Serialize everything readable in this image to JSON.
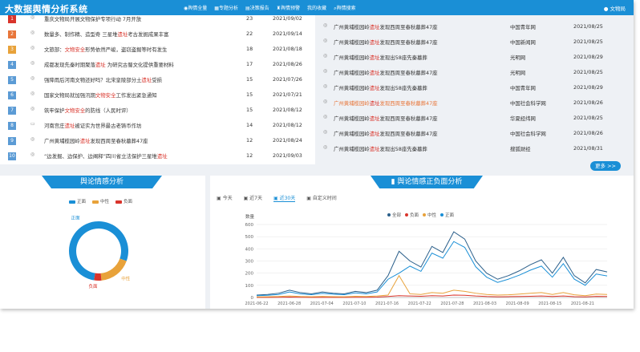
{
  "app": {
    "title": "大数据舆情分析系统",
    "user": "文物局",
    "nav": [
      "舆情全量",
      "专题分析",
      "决策报告",
      "舆情预警",
      "我的收藏",
      "舆情搜索"
    ],
    "colors": {
      "accent": "#1a8fd6",
      "keyword": "#d9342b"
    }
  },
  "hot_list": [
    {
      "rank": "1",
      "t1": "重庆文物局开展文物保护",
      "kw": "",
      "t2": "专项行动 7月开放",
      "num": "23",
      "date": "2021/09/02",
      "color": "#d9342b"
    },
    {
      "rank": "2",
      "t1": "数量多、制作精、造型奇 三星堆",
      "kw": "遗址",
      "t2": "考古发掘成果丰富",
      "num": "22",
      "date": "2021/09/14",
      "color": "#e8763a"
    },
    {
      "rank": "3",
      "t1": "文旅部：",
      "kw": "文物安全",
      "t2": "形势依然严峻，盗窃盗掘等时有发生",
      "num": "18",
      "date": "2021/08/18",
      "color": "#e8a23a"
    },
    {
      "rank": "4",
      "t1": "成都发现先秦时期聚落",
      "kw": "遗址",
      "t2": " 为研究古蜀文化提供重要材料",
      "num": "17",
      "date": "2021/08/26",
      "color": "#5b9bd5"
    },
    {
      "rank": "5",
      "t1": "强降雨后河南文物还好吗？北宋皇陵部分土",
      "kw": "遗址",
      "t2": "受损",
      "num": "15",
      "date": "2021/07/26",
      "color": "#5b9bd5"
    },
    {
      "rank": "6",
      "t1": "国家文物局就加强汛期",
      "kw": "文物安全",
      "t2": "工作发出紧急通知",
      "num": "15",
      "date": "2021/07/21",
      "color": "#5b9bd5"
    },
    {
      "rank": "7",
      "t1": "筑牢保护",
      "kw": "文物安全",
      "t2": "的防线（人民时评）",
      "num": "15",
      "date": "2021/08/12",
      "color": "#5b9bd5"
    },
    {
      "rank": "8",
      "t1": "河南宫庄",
      "kw": "遗址",
      "t2": "被证实为世界最古老铸币作坊",
      "num": "14",
      "date": "2021/08/12",
      "color": "#5b9bd5"
    },
    {
      "rank": "9",
      "t1": "广州黄埔榄园岭",
      "kw": "遗址",
      "t2": "发现西周至春秋墓葬47座",
      "num": "12",
      "date": "2021/08/24",
      "color": "#5b9bd5"
    },
    {
      "rank": "10",
      "t1": "“边发掘、边保护、边阐释”四川省立法保护三星堆",
      "kw": "遗址",
      "t2": "",
      "num": "12",
      "date": "2021/09/03",
      "color": "#5b9bd5"
    }
  ],
  "news_list": [
    {
      "t1": "广州黄埔榄园岭",
      "kw": "遗址",
      "t2": "发现西周至春秋墓葬47座",
      "source": "中国青年网",
      "date": "2021/08/25",
      "orange": false
    },
    {
      "t1": "广州黄埔榄园岭",
      "kw": "遗址",
      "t2": "发现西周至春秋墓葬47座",
      "source": "中国新闻网",
      "date": "2021/08/25",
      "orange": false
    },
    {
      "t1": "广州黄埔榄园岭",
      "kw": "遗址",
      "t2": "发现出58座先秦墓葬",
      "source": "光明网",
      "date": "2021/08/29",
      "orange": false
    },
    {
      "t1": "广州黄埔榄园岭",
      "kw": "遗址",
      "t2": "发现西周至春秋墓葬47座",
      "source": "光明网",
      "date": "2021/08/25",
      "orange": false
    },
    {
      "t1": "广州黄埔榄园岭",
      "kw": "遗址",
      "t2": "发现出58座先秦墓葬",
      "source": "中国青年网",
      "date": "2021/08/29",
      "orange": false
    },
    {
      "t1": "广州黄埔榄园岭",
      "kw": "遗址",
      "t2": "发现西周至春秋墓葬47座",
      "source": "中国社会科学网",
      "date": "2021/08/26",
      "orange": true
    },
    {
      "t1": "广州黄埔榄园岭",
      "kw": "遗址",
      "t2": "发现西周至春秋墓葬47座",
      "source": "华夏经纬网",
      "date": "2021/08/25",
      "orange": false
    },
    {
      "t1": "广州黄埔榄园岭",
      "kw": "遗址",
      "t2": "发现西周至春秋墓葬47座",
      "source": "中国社会科学网",
      "date": "2021/08/26",
      "orange": false
    },
    {
      "t1": "广州黄埔榄园岭",
      "kw": "遗址",
      "t2": "发现出58座先秦墓葬",
      "source": "搜狐财经",
      "date": "2021/08/31",
      "orange": false
    }
  ],
  "more_label": "更多 >>",
  "sentiment": {
    "title": "舆论情感分析",
    "legend": [
      "正面",
      "中性",
      "负面"
    ],
    "colors": [
      "#1a8fd6",
      "#e8a23a",
      "#d9342b"
    ],
    "slice_labels": [
      "负面",
      "中性",
      "正面"
    ]
  },
  "trend": {
    "title": "舆论情感正负面分析",
    "tabs": [
      "今天",
      "近7天",
      "近30天",
      "自定义时间"
    ],
    "active_tab": 2,
    "ylabel": "数量",
    "legend": [
      "全部",
      "负面",
      "中性",
      "正面"
    ]
  },
  "chart_data": [
    {
      "type": "pie",
      "title": "舆论情感分析",
      "categories": [
        "正面",
        "中性",
        "负面"
      ],
      "values": [
        78,
        18,
        4
      ],
      "colors": [
        "#1a8fd6",
        "#e8a23a",
        "#d9342b"
      ],
      "legend_position": "top"
    },
    {
      "type": "line",
      "title": "舆论情感正负面分析",
      "ylabel": "数量",
      "ylim": [
        0,
        600
      ],
      "yticks": [
        0,
        100,
        200,
        300,
        400,
        500,
        600
      ],
      "xticks": [
        "2021-06-22",
        "2021-06-28",
        "2021-07-04",
        "2021-07-10",
        "2021-07-16",
        "2021-07-22",
        "2021-07-28",
        "2021-08-03",
        "2021-08-09",
        "2021-08-15",
        "2021-08-21"
      ],
      "x": [
        "06-22",
        "06-24",
        "06-26",
        "06-28",
        "06-30",
        "07-02",
        "07-04",
        "07-06",
        "07-08",
        "07-10",
        "07-12",
        "07-14",
        "07-16",
        "07-18",
        "07-20",
        "07-22",
        "07-24",
        "07-26",
        "07-28",
        "07-30",
        "08-01",
        "08-03",
        "08-05",
        "08-07",
        "08-09",
        "08-11",
        "08-13",
        "08-15",
        "08-17",
        "08-19",
        "08-21",
        "08-23",
        "08-25"
      ],
      "series": [
        {
          "name": "全部",
          "color": "#2b5f8a",
          "values": [
            20,
            25,
            35,
            60,
            40,
            30,
            45,
            35,
            30,
            50,
            40,
            60,
            180,
            380,
            300,
            250,
            420,
            370,
            540,
            480,
            300,
            200,
            150,
            180,
            220,
            270,
            310,
            200,
            330,
            180,
            120,
            230,
            210
          ]
        },
        {
          "name": "负面",
          "color": "#d9342b",
          "values": [
            1,
            1,
            2,
            3,
            2,
            1,
            2,
            1,
            1,
            2,
            2,
            3,
            8,
            15,
            12,
            10,
            15,
            12,
            20,
            18,
            12,
            8,
            6,
            7,
            8,
            10,
            12,
            8,
            12,
            7,
            5,
            9,
            8
          ]
        },
        {
          "name": "中性",
          "color": "#e8a23a",
          "values": [
            5,
            6,
            8,
            12,
            8,
            6,
            9,
            7,
            6,
            10,
            8,
            12,
            20,
            180,
            30,
            25,
            40,
            35,
            60,
            50,
            35,
            25,
            20,
            22,
            28,
            35,
            40,
            25,
            40,
            22,
            15,
            28,
            25
          ]
        },
        {
          "name": "正面",
          "color": "#1a8fd6",
          "values": [
            15,
            18,
            25,
            45,
            30,
            23,
            34,
            27,
            23,
            38,
            30,
            45,
            150,
            200,
            258,
            215,
            365,
            323,
            460,
            412,
            253,
            167,
            124,
            151,
            184,
            225,
            258,
            167,
            278,
            151,
            100,
            193,
            177
          ]
        }
      ]
    }
  ]
}
